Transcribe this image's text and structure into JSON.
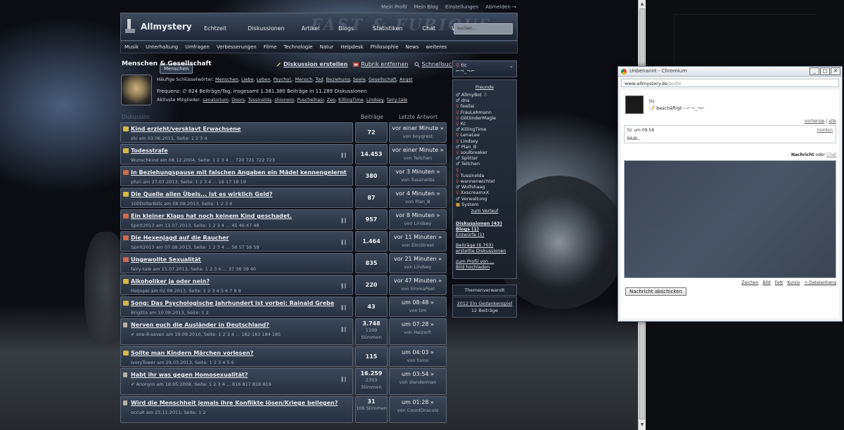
{
  "top_links": [
    "Mein Profil",
    "Mein Blog",
    "Einstellungen",
    "Abmelden →"
  ],
  "brand": "Allmystery",
  "main_nav": [
    "Echtzeit",
    "Diskussionen",
    "Artikel",
    "Blogs",
    "Statistiken",
    "Chat",
    "Wiki"
  ],
  "search": {
    "placeholder": "suchen..."
  },
  "sub_nav": [
    "Musik",
    "Menschen",
    "Unterhaltung",
    "Umfragen",
    "Verbesserungen",
    "Filme",
    "Technologie",
    "Natur",
    "Helpdesk",
    "Philosophie",
    "News",
    "weiteres"
  ],
  "sub_nav_active": "Menschen",
  "page_title": "Menschen & Gesellschaft",
  "actions": {
    "create": "Diskussion erstellen",
    "remove": "Rubrik entfernen",
    "quick": "Schnellsuche"
  },
  "keywords": {
    "label": "Häufige Schlüsselwörter:",
    "items": [
      "Menschen",
      "Liebe",
      "Leben",
      "Psychol.",
      "Mensch",
      "Tod",
      "Beziehung",
      "Seele",
      "Gesellschaft",
      "Angst"
    ]
  },
  "frequency": "Frequenz: ∅ 824 Beiträge/Tag, insgesamt 1.381.380 Beiträge in 11.289 Diskussionen",
  "active_members": {
    "label": "Aktivste Mitglieder:",
    "items": [
      "sanatorium",
      "Doors",
      "Tussinelda",
      "shionoro",
      "Puschelhasi",
      "Zeo",
      "KillingTime",
      "Lindsey",
      "fairy-tale"
    ]
  },
  "columns": {
    "topic": "Diskussion",
    "posts": "Beiträge",
    "last": "Letzte Antwort"
  },
  "topics": [
    {
      "title": "Kind erzieht/versklavt Erwachsene",
      "meta": "shi am 03.06.2011, Seite: 1 2 3 4",
      "posts": "72",
      "sub": "",
      "when": "vor einer Minute »",
      "by": "von boygrest",
      "icon": "yellow",
      "bars": ""
    },
    {
      "title": "Todesstrafe",
      "meta": "Wunschkind am 08.12.2004, Seite: 1 2 3 4 ... 720 721 722 723",
      "posts": "14.453",
      "sub": "",
      "when": "vor einer Minute »",
      "by": "von Teilchen",
      "icon": "yellow",
      "bars": "▍▎"
    },
    {
      "title": "In Beziehungspause mit falschen Angaben ein Mädel kennengelernt",
      "meta": "pfuri am 27.07.2013, Seite: 1 2 3 4 ... 16 17 18 19",
      "posts": "380",
      "sub": "",
      "when": "vor 3 Minuten »",
      "by": "von Tussinelda",
      "icon": "red",
      "bars": ""
    },
    {
      "title": "Die Quelle allen Übels... ist es wirklich Geld?",
      "meta": "100DollarBills am 08.08.2013, Seite: 1 2 3 4",
      "posts": "87",
      "sub": "",
      "when": "vor 4 Minuten »",
      "by": "von Plan_B",
      "icon": "yellow",
      "bars": ""
    },
    {
      "title": "Ein kleiner Klaps hat noch keinem Kind geschadet.",
      "meta": "Spirit2013 am 11.07.2013, Seite: 1 2 3 4 ... 45 46 47 48",
      "posts": "957",
      "sub": "",
      "when": "vor 8 Minuten »",
      "by": "von Lindsey",
      "icon": "red",
      "bars": "▍▎"
    },
    {
      "title": "Die Hexenjagd auf die Raucher",
      "meta": "Spirit2013 am 07.08.2013, Seite: 1 2 3 4 ... 56 57 58 59",
      "posts": "1.464",
      "sub": "",
      "when": "vor 11 Minuten »",
      "by": "von ElmStreet",
      "icon": "red",
      "bars": "▍▎"
    },
    {
      "title": "Ungewollte Sexualität",
      "meta": "fairy-tale am 15.07.2013, Seite: 1 2 3 4 ... 37 38 39 40",
      "posts": "835",
      "sub": "",
      "when": "vor 21 Minuten »",
      "by": "von Lindsey",
      "icon": "red",
      "bars": ""
    },
    {
      "title": "Alkoholiker ja oder nein?",
      "meta": "Heijopei am 02.08.2013, Seite: 1 2 3 4 5 6 7 8 9",
      "posts": "220",
      "sub": "",
      "when": "vor 47 Minuten »",
      "by": "von EmmaPeel",
      "icon": "yellow",
      "bars": "▍▎"
    },
    {
      "title": "Song: Das Psychologische Jahrhundert ist vorbei: Rainald Grebe",
      "meta": "Brigitta am 10.08.2013, Seite: 1 2",
      "posts": "43",
      "sub": "",
      "when": "um 08:48 »",
      "by": "von tim",
      "icon": "yellow",
      "bars": "▍▎"
    },
    {
      "title": "Nerven euch die Ausländer in Deutschland?",
      "meta": "✔ one-8-seven am 19.09.2010, Seite: 1 2 3 4 ... 182 183 184 185",
      "posts": "3.748",
      "sub": "1199 Stimmen",
      "when": "um 07:28 »",
      "by": "von HeizerP.",
      "icon": "gray",
      "bars": "▍▎"
    },
    {
      "title": "Sollte man Kindern Märchen vorlesen?",
      "meta": "IvoryTower am 29.03.2013, Seite: 1 2 3 4 5 6",
      "posts": "115",
      "sub": "",
      "when": "um 04:03 »",
      "by": "von fumo",
      "icon": "yellow",
      "bars": ""
    },
    {
      "title": "Habt ihr was gegen Homosexualität?",
      "meta": "✔ Anonym am 18.05.2008, Seite: 1 2 3 4 ... 816 817 818 819",
      "posts": "16.259",
      "sub": "2353 Stimmen",
      "when": "um 03:54 »",
      "by": "von slanderman",
      "icon": "gray",
      "bars": "▍▎"
    },
    {
      "title": "Wird die Menschheit jemals ihre Konflikte lösen/Kriege beilegen?",
      "meta": "occult am 23.11.2011, Seite: 1 2",
      "posts": "31",
      "sub": "108 Stimmen",
      "when": "um 01:28 »",
      "by": "von CountDracula",
      "icon": "gray",
      "bars": ""
    }
  ],
  "sidebar": {
    "user": "tic",
    "status": "⌐¬_¬⌐",
    "friends_header": "Freunde",
    "friends": [
      {
        "name": "AllmyBot ☃",
        "g": "m"
      },
      {
        "name": "dns",
        "g": "m"
      },
      {
        "name": "feallai",
        "g": "f"
      },
      {
        "name": "FrauLehmann",
        "g": "f"
      },
      {
        "name": "GöttinderMagie",
        "g": "f"
      },
      {
        "name": "Kc",
        "g": "f"
      },
      {
        "name": "KillingTime",
        "g": "m"
      },
      {
        "name": "LenaLee",
        "g": "f"
      },
      {
        "name": "Lindsey",
        "g": "f"
      },
      {
        "name": "Plan_B",
        "g": "m"
      },
      {
        "name": "soulbreaker",
        "g": "f"
      },
      {
        "name": "Splitter",
        "g": "m"
      },
      {
        "name": "Teilchen",
        "g": "m"
      },
      {
        "name": "",
        "g": "f"
      },
      {
        "name": "Tussinelda",
        "g": "f"
      },
      {
        "name": "wannenwichtel",
        "g": "f"
      },
      {
        "name": "Wolfshaag",
        "g": "m"
      },
      {
        "name": "XxscreamxX",
        "g": "f"
      },
      {
        "name": "Verwaltung",
        "g": "m"
      },
      {
        "name": "System",
        "g": "s"
      }
    ],
    "history": "zum Verlauf",
    "links1": [
      "Diskussionen (43)",
      "Blogs (1)",
      "Entwürfe (1)"
    ],
    "links2": [
      "Beiträge (6.703)",
      "erstellte Diskussionen"
    ],
    "links3": [
      "zum Profil von ...",
      "Bild hochladen"
    ],
    "related_header": "Themenverwandt",
    "related_title": "2012 Ein Gedankenspiel",
    "related_count": "12 Beiträge"
  },
  "popup": {
    "title": "Unbenannt - Chromium",
    "url_host": "www.allmystery.de",
    "url_path": "/pn/tic",
    "user": "tic",
    "status": "📝 beschäftigt – ⌐¬_¬⌐",
    "nav_prev": "vorherige",
    "nav_all": "alle",
    "msg_header": "tic um 09:58",
    "msg_report": "melden",
    "msg_text": "blub..",
    "tab_msg": "Nachricht",
    "tab_or": "oder",
    "tab_chat": "Chat",
    "tools": [
      "Zeichen",
      "Bild",
      "Fett",
      "Kursiv",
      "+ Dateianhang"
    ],
    "send": "Nachricht abschicken"
  }
}
